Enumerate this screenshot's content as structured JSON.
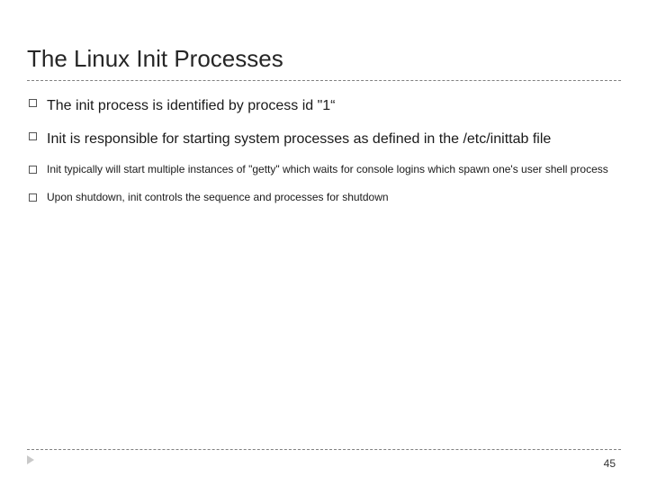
{
  "title": "The Linux Init Processes",
  "bullets": {
    "b1": "The init process is identified by process id \"1“",
    "b2": "Init is responsible for starting system processes as defined in the /etc/inittab file",
    "b3": "Init typically will start multiple instances of \"getty\" which waits for console logins which spawn one's user shell process",
    "b4": "Upon shutdown, init controls the sequence and processes for shutdown"
  },
  "page_number": "45"
}
